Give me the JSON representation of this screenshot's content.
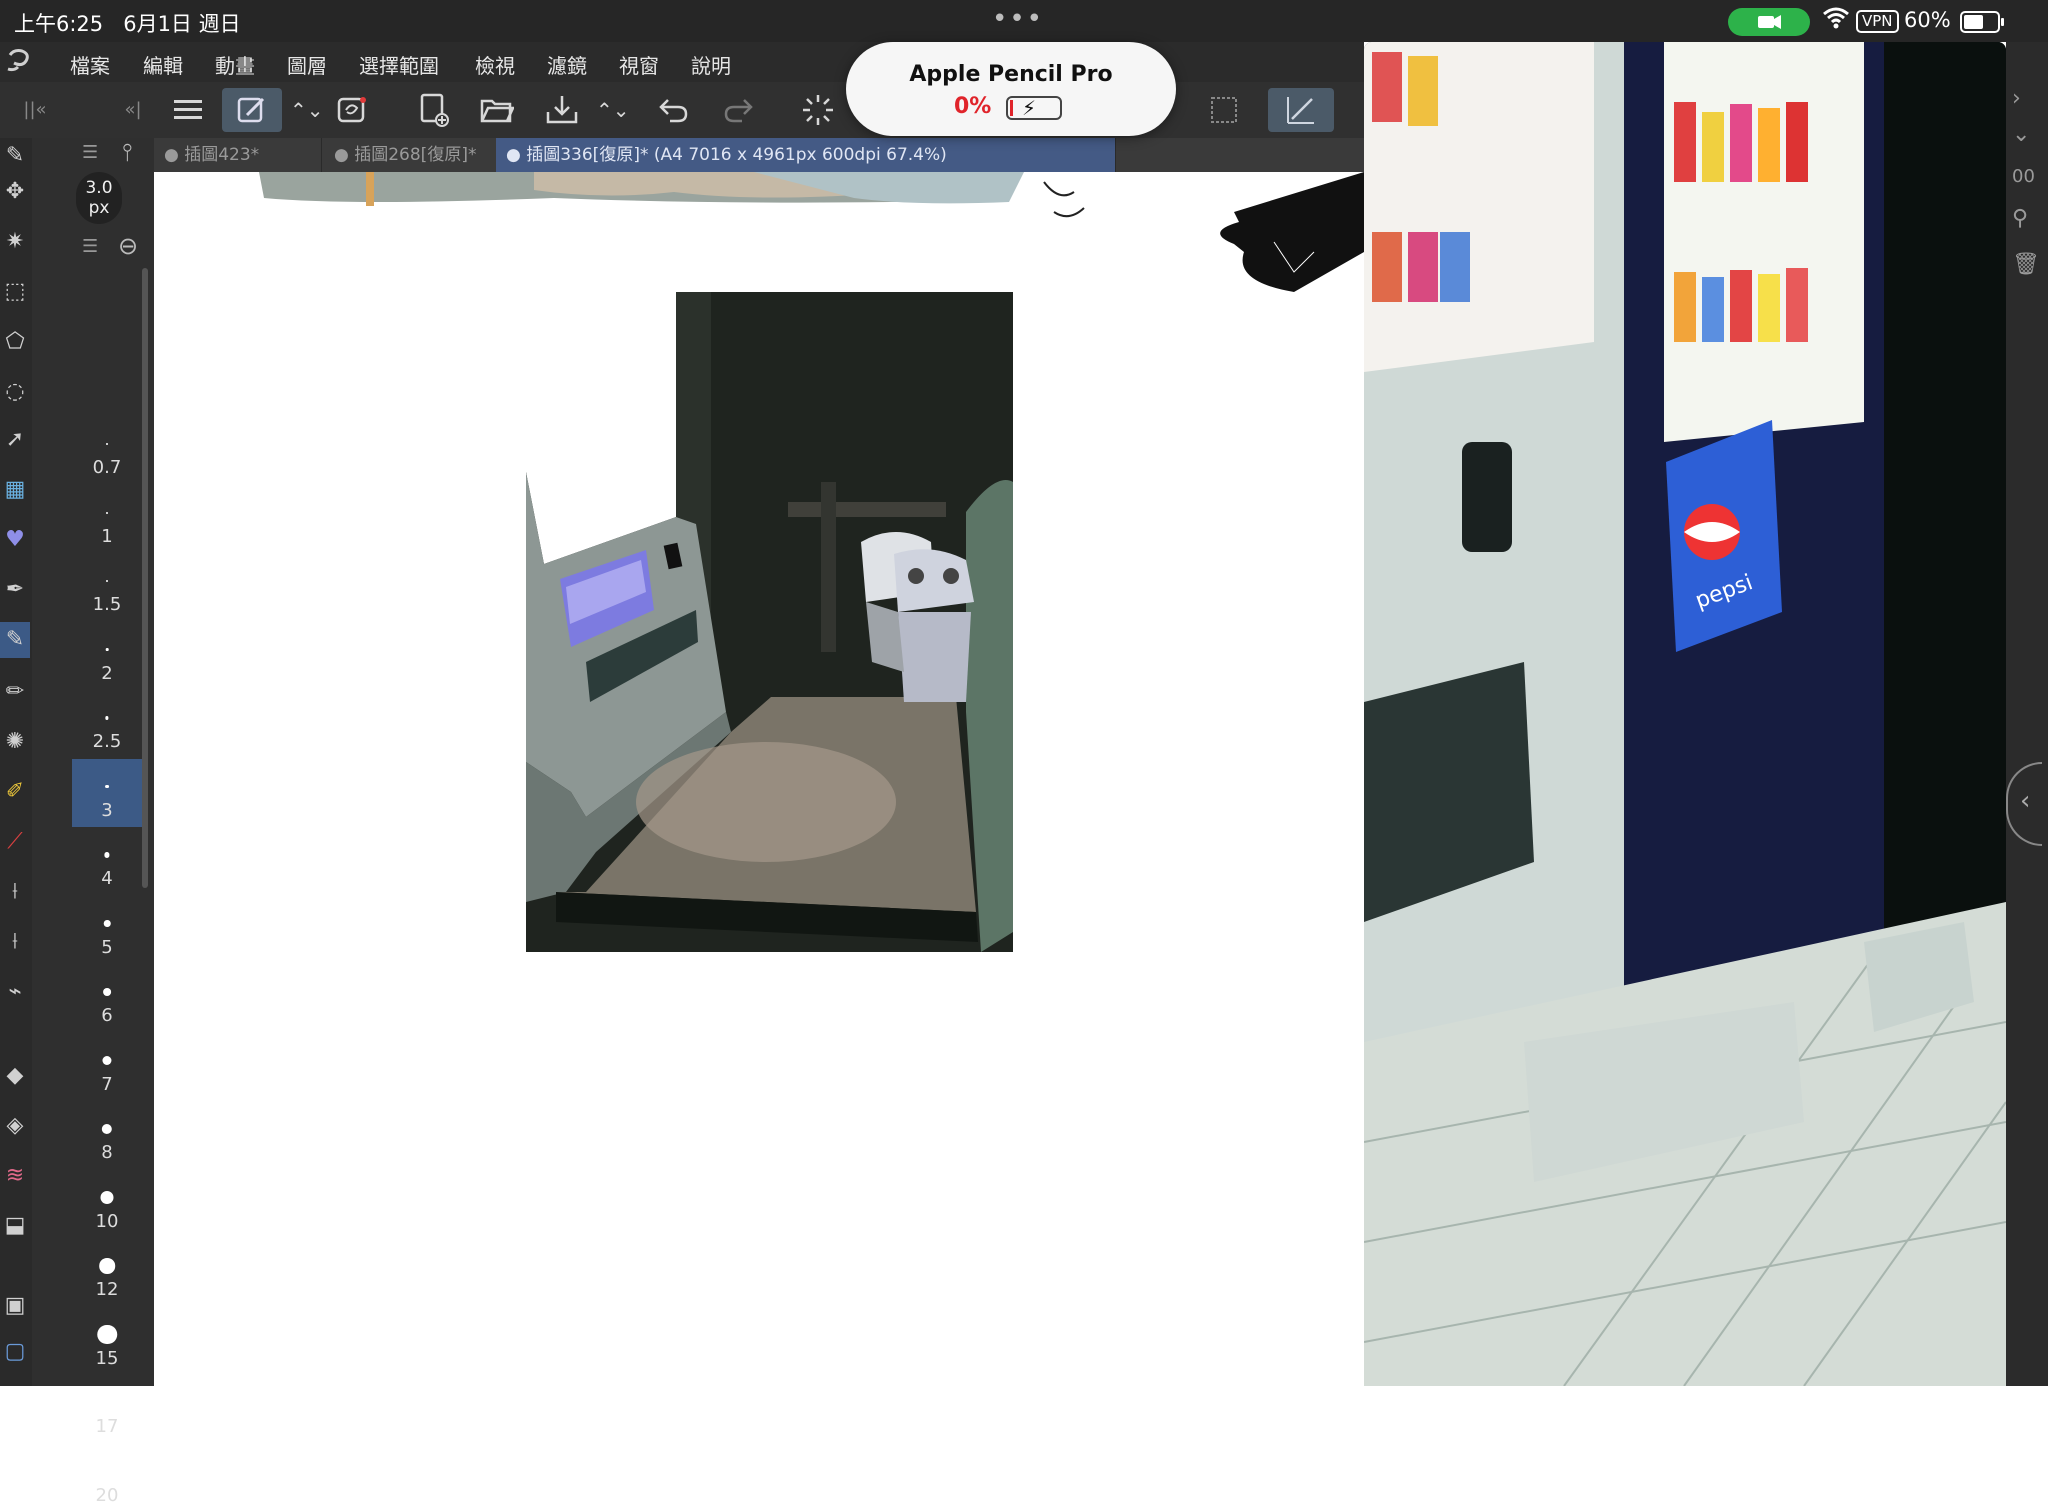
{
  "status_bar": {
    "time": "上午6:25",
    "date": "6月1日 週日",
    "vpn": "VPN",
    "battery_pct": "60%",
    "battery_level": 0.6
  },
  "menu": [
    "檔案",
    "編輯",
    "動畫",
    "圖層",
    "選擇範圍",
    "檢視",
    "濾鏡",
    "視窗",
    "說明"
  ],
  "pencil_popup": {
    "name": "Apple Pencil Pro",
    "charge": "0%"
  },
  "tabs": [
    {
      "label": "● 插圖423*"
    },
    {
      "label": "● 插圖268[復原]*"
    },
    {
      "label": "● 插圖336[復原]* (A4 7016 x 4961px 600dpi 67.4%)"
    }
  ],
  "brush": {
    "current_value": "3.0",
    "current_unit": "px",
    "sizes": [
      "0.7",
      "1",
      "1.5",
      "2",
      "2.5",
      "3",
      "4",
      "5",
      "6",
      "7",
      "8",
      "10",
      "12",
      "15",
      "17",
      "20"
    ],
    "selected": "3"
  },
  "right_edge": {
    "partial_value": "00"
  },
  "reference_image": {
    "brand_text": "pepsi"
  },
  "colors": {
    "accent": "#3c5a86",
    "active_tab": "#445a85",
    "camera_indicator": "#2db24a",
    "pencil_low": "#e0242b"
  }
}
